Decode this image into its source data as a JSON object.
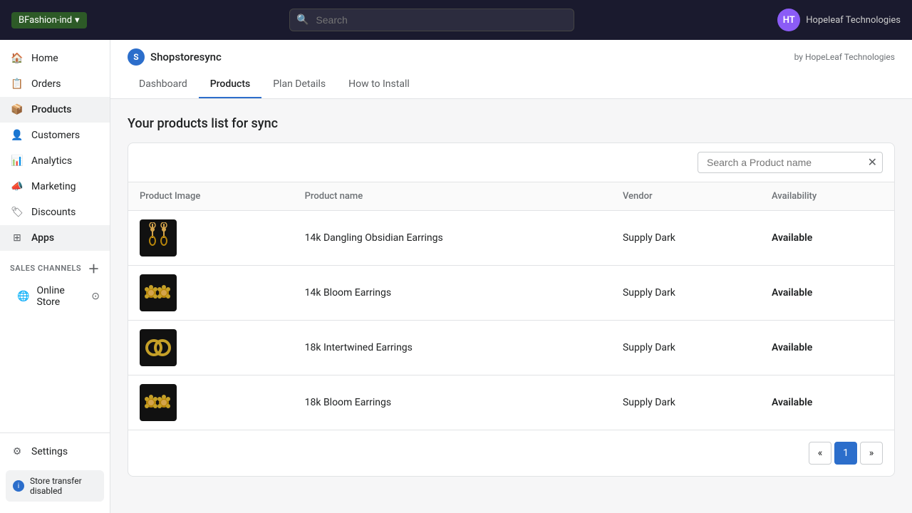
{
  "topbar": {
    "store_name": "BFashion-ind",
    "chevron": "▾",
    "search_placeholder": "Search",
    "avatar_initials": "HT",
    "company": "Hopeleaf Technologies"
  },
  "sidebar": {
    "items": [
      {
        "id": "home",
        "label": "Home",
        "icon": "🏠"
      },
      {
        "id": "orders",
        "label": "Orders",
        "icon": "📋"
      },
      {
        "id": "products",
        "label": "Products",
        "icon": "📦",
        "active": true
      },
      {
        "id": "customers",
        "label": "Customers",
        "icon": "👤"
      },
      {
        "id": "analytics",
        "label": "Analytics",
        "icon": "📊"
      },
      {
        "id": "marketing",
        "label": "Marketing",
        "icon": "📣"
      },
      {
        "id": "discounts",
        "label": "Discounts",
        "icon": "🏷"
      },
      {
        "id": "apps",
        "label": "Apps",
        "icon": "⚙"
      }
    ],
    "sales_channels_label": "SALES CHANNELS",
    "online_store": "Online Store",
    "settings_label": "Settings",
    "store_transfer_label": "Store transfer disabled"
  },
  "app": {
    "logo_text": "S",
    "title": "Shopstoresync",
    "by_label": "by HopeLeaf Technologies",
    "tabs": [
      {
        "id": "dashboard",
        "label": "Dashboard"
      },
      {
        "id": "products",
        "label": "Products",
        "active": true
      },
      {
        "id": "plan_details",
        "label": "Plan Details"
      },
      {
        "id": "how_to_install",
        "label": "How to Install"
      }
    ]
  },
  "products_page": {
    "section_title": "Your products list for sync",
    "search_placeholder": "Search a Product name",
    "table": {
      "columns": [
        {
          "id": "image",
          "label": "Product Image"
        },
        {
          "id": "name",
          "label": "Product name"
        },
        {
          "id": "vendor",
          "label": "Vendor"
        },
        {
          "id": "availability",
          "label": "Availability"
        }
      ],
      "rows": [
        {
          "id": 1,
          "name": "14k Dangling Obsidian Earrings",
          "vendor": "Supply Dark",
          "availability": "Available",
          "image_type": "dangling"
        },
        {
          "id": 2,
          "name": "14k Bloom Earrings",
          "vendor": "Supply Dark",
          "availability": "Available",
          "image_type": "bloom"
        },
        {
          "id": 3,
          "name": "18k Intertwined Earrings",
          "vendor": "Supply Dark",
          "availability": "Available",
          "image_type": "rings"
        },
        {
          "id": 4,
          "name": "18k Bloom Earrings",
          "vendor": "Supply Dark",
          "availability": "Available",
          "image_type": "bloom"
        }
      ]
    },
    "pagination": {
      "prev": "«",
      "current": "1",
      "next": "»"
    }
  },
  "colors": {
    "active_tab": "#2c6ecb",
    "available": "#202223",
    "page_active_bg": "#2c6ecb"
  }
}
